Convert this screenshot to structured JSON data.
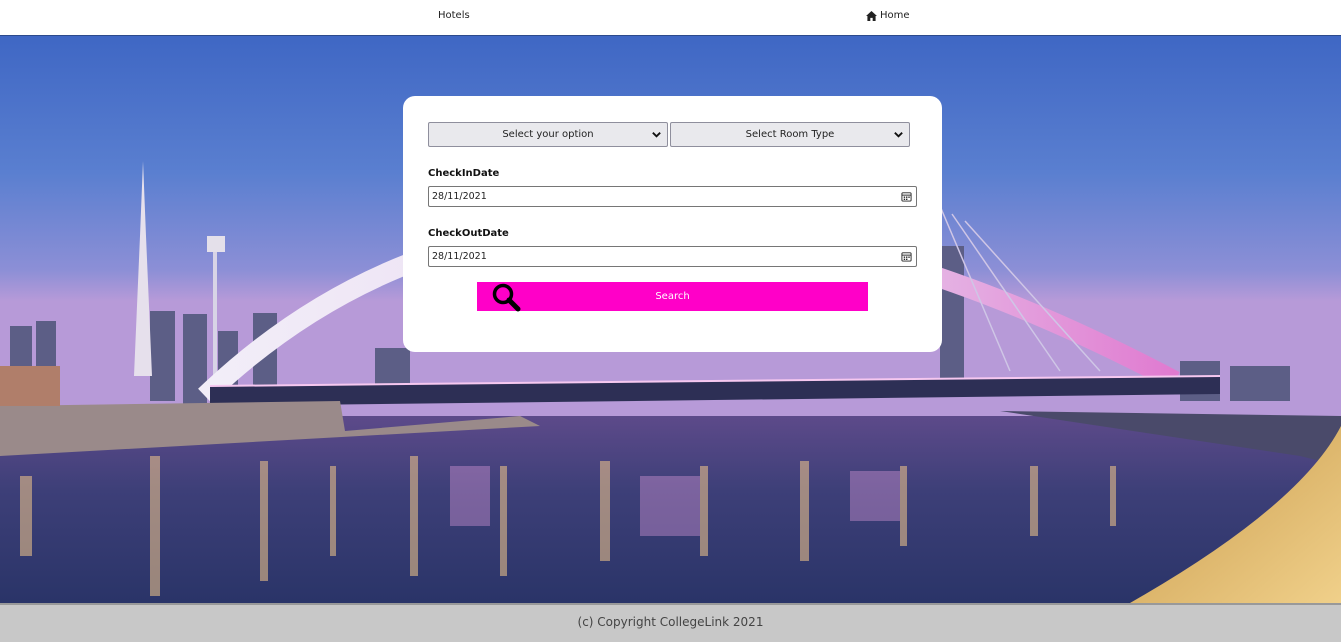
{
  "nav": {
    "hotels_label": "Hotels",
    "home_label": "Home",
    "home_icon": "home-icon"
  },
  "form": {
    "hotel_select": {
      "selected": "Select your option",
      "icon": "chevron-down-icon"
    },
    "room_select": {
      "selected": "Select Room Type",
      "icon": "chevron-down-icon"
    },
    "checkin": {
      "label": "CheckInDate",
      "value": "28/11/2021",
      "icon": "calendar-icon"
    },
    "checkout": {
      "label": "CheckOutDate",
      "value": "28/11/2021",
      "icon": "calendar-icon"
    },
    "search": {
      "label": "Search",
      "icon": "search-icon",
      "color": "#ff00c8"
    }
  },
  "footer": {
    "text": "(c) Copyright CollegeLink 2021"
  }
}
